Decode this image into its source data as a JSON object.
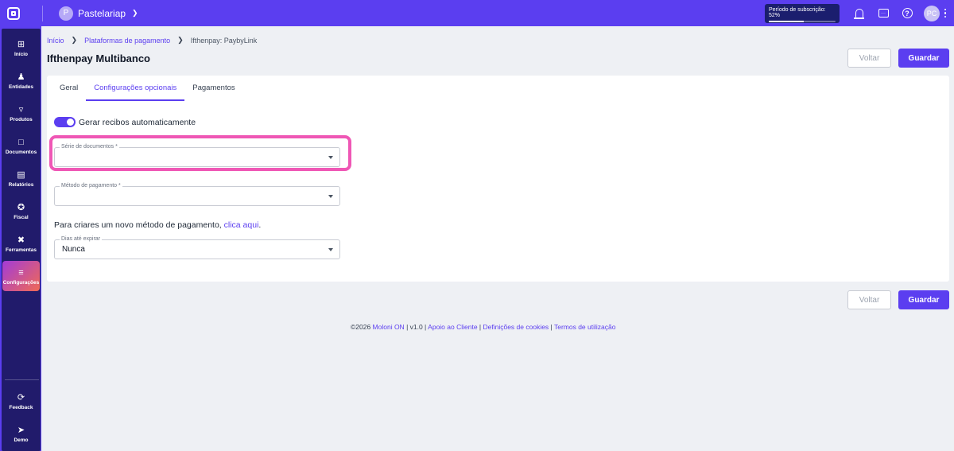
{
  "topbar": {
    "company_initial": "P",
    "company_name": "Pastelariap",
    "subscription_label": "Período de subscrição: 52%",
    "subscription_progress": 0.52,
    "user_initials": "PC"
  },
  "sidebar": {
    "items": [
      {
        "label": "Início",
        "icon": "home-icon"
      },
      {
        "label": "Entidades",
        "icon": "user-icon"
      },
      {
        "label": "Produtos",
        "icon": "basket-icon"
      },
      {
        "label": "Documentos",
        "icon": "document-icon"
      },
      {
        "label": "Relatórios",
        "icon": "chart-icon"
      },
      {
        "label": "Fiscal",
        "icon": "network-icon"
      },
      {
        "label": "Ferramentas",
        "icon": "tools-icon"
      },
      {
        "label": "Configurações",
        "icon": "sliders-icon"
      }
    ],
    "bottom_items": [
      {
        "label": "Feedback",
        "icon": "feedback-icon"
      },
      {
        "label": "Demo",
        "icon": "rocket-icon"
      }
    ]
  },
  "breadcrumb": {
    "home": "Início",
    "parent": "Plataformas de pagamento",
    "current": "Ifthenpay: PaybyLink"
  },
  "page": {
    "title": "Ifthenpay Multibanco",
    "back_label": "Voltar",
    "save_label": "Guardar"
  },
  "tabs": [
    {
      "label": "Geral"
    },
    {
      "label": "Configurações opcionais"
    },
    {
      "label": "Pagamentos"
    }
  ],
  "form": {
    "auto_receipts_label": "Gerar recibos automaticamente",
    "auto_receipts_enabled": true,
    "document_series": {
      "label": "Série de documentos *",
      "value": ""
    },
    "payment_method": {
      "label": "Método de pagamento *",
      "value": ""
    },
    "create_method_text": "Para criares um novo método de pagamento, ",
    "create_method_link": "clica aqui",
    "create_method_end": ".",
    "days_to_expire": {
      "label": "Dias até expirar",
      "value": "Nunca"
    }
  },
  "footer": {
    "copyright": "©2026 ",
    "brand": "Moloni ON",
    "version": " | v1.0 | ",
    "support": "Apoio ao Cliente",
    "sep1": " | ",
    "cookies": "Definições de cookies",
    "sep2": " | ",
    "terms": "Termos de utilização"
  }
}
